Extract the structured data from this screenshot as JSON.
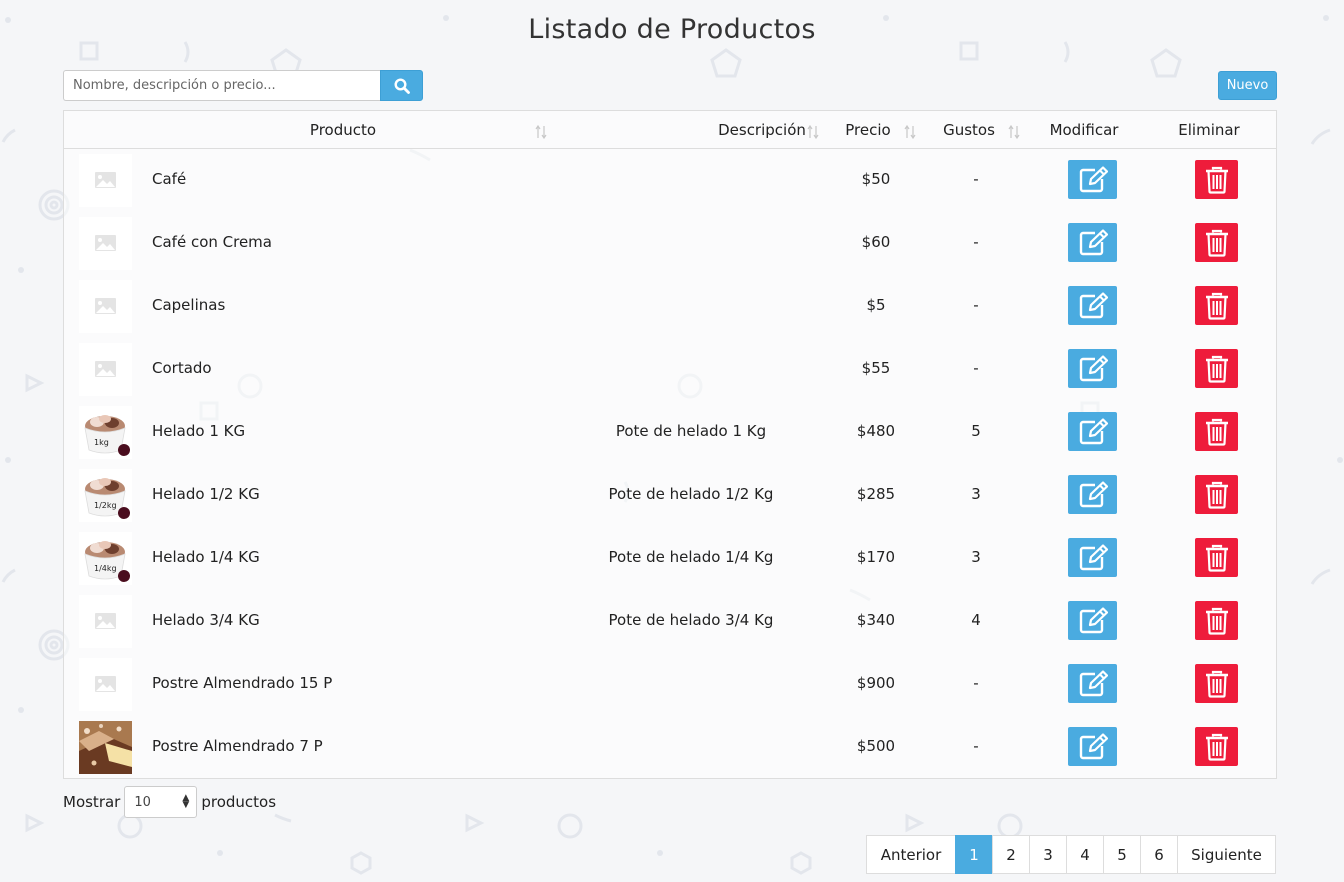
{
  "page": {
    "title": "Listado de Productos"
  },
  "search": {
    "placeholder": "Nombre, descripción o precio...",
    "button_icon": "search-icon"
  },
  "toolbar": {
    "new_label": "Nuevo"
  },
  "table": {
    "columns": [
      "Producto",
      "Descripción",
      "Precio",
      "Gustos",
      "Modificar",
      "Eliminar"
    ],
    "rows": [
      {
        "image": "placeholder",
        "name": "Café",
        "description": "",
        "price": "$50",
        "flavors": "-"
      },
      {
        "image": "placeholder",
        "name": "Café con Crema",
        "description": "",
        "price": "$60",
        "flavors": "-"
      },
      {
        "image": "placeholder",
        "name": "Capelinas",
        "description": "",
        "price": "$5",
        "flavors": "-"
      },
      {
        "image": "placeholder",
        "name": "Cortado",
        "description": "",
        "price": "$55",
        "flavors": "-"
      },
      {
        "image": "ice-cream-tub",
        "image_text": "1kg",
        "name": "Helado 1 KG",
        "description": "Pote de helado 1 Kg",
        "price": "$480",
        "flavors": "5"
      },
      {
        "image": "ice-cream-tub",
        "image_text": "1/2kg",
        "name": "Helado 1/2 KG",
        "description": "Pote de helado 1/2 Kg",
        "price": "$285",
        "flavors": "3"
      },
      {
        "image": "ice-cream-tub",
        "image_text": "1/4kg",
        "name": "Helado 1/4 KG",
        "description": "Pote de helado 1/4 Kg",
        "price": "$170",
        "flavors": "3"
      },
      {
        "image": "placeholder",
        "name": "Helado 3/4 KG",
        "description": "Pote de helado 3/4 Kg",
        "price": "$340",
        "flavors": "4"
      },
      {
        "image": "placeholder",
        "name": "Postre Almendrado 15 P",
        "description": "",
        "price": "$900",
        "flavors": "-"
      },
      {
        "image": "cake",
        "name": "Postre Almendrado 7 P",
        "description": "",
        "price": "$500",
        "flavors": "-"
      }
    ]
  },
  "length_menu": {
    "prefix": "Mostrar",
    "value": "10",
    "suffix": "productos"
  },
  "pagination": {
    "prev": "Anterior",
    "pages": [
      "1",
      "2",
      "3",
      "4",
      "5",
      "6"
    ],
    "active": "1",
    "next": "Siguiente"
  },
  "colors": {
    "accent": "#4aabe0",
    "danger": "#ee1c3b",
    "background": "#f5f6f8"
  }
}
